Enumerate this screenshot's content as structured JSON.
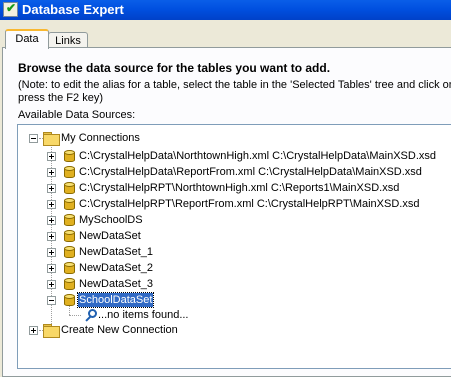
{
  "window": {
    "title": "Database Expert"
  },
  "tabs": [
    {
      "label": "Data"
    },
    {
      "label": "Links"
    }
  ],
  "main": {
    "heading": "Browse the data source for the tables you want to add.",
    "note_line1": "(Note: to edit the alias for a table, select the table in the 'Selected Tables' tree and click on i",
    "note_line2": "press the F2 key)",
    "available_label": "Available Data Sources:"
  },
  "tree": {
    "root_label": "My Connections",
    "connections": [
      "C:\\CrystalHelpData\\NorthtownHigh.xml C:\\CrystalHelpData\\MainXSD.xsd",
      "C:\\CrystalHelpData\\ReportFrom.xml C:\\CrystalHelpData\\MainXSD.xsd",
      "C:\\CrystalHelpRPT\\NorthtownHigh.xml C:\\Reports1\\MainXSD.xsd",
      "C:\\CrystalHelpRPT\\ReportFrom.xml C:\\CrystalHelpRPT\\MainXSD.xsd",
      "MySchoolDS",
      "NewDataSet",
      "NewDataSet_1",
      "NewDataSet_2",
      "NewDataSet_3",
      "SchoolDataSet"
    ],
    "selected": "SchoolDataSet",
    "child_message": "...no items found...",
    "create_label": "Create New Connection"
  }
}
